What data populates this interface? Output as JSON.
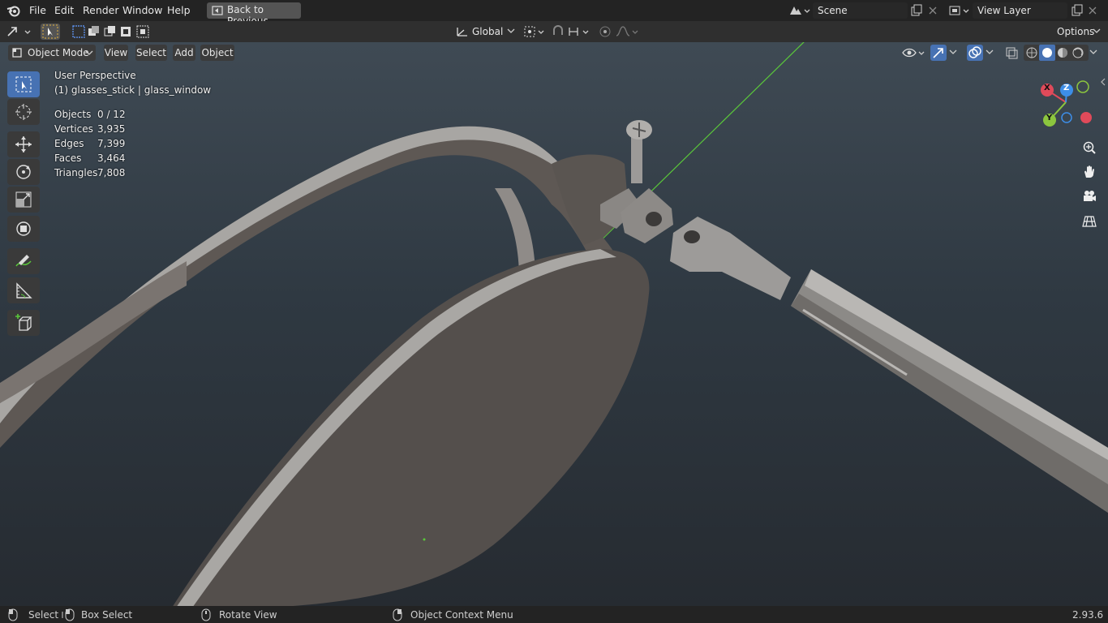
{
  "menu": {
    "file": "File",
    "edit": "Edit",
    "render": "Render",
    "window": "Window",
    "help": "Help",
    "back": "Back to Previous"
  },
  "scene": {
    "label": "Scene",
    "view_layer": "View Layer"
  },
  "toolbar": {
    "orientation": "Global",
    "options": "Options"
  },
  "header": {
    "mode": "Object Mode",
    "view": "View",
    "select": "Select",
    "add": "Add",
    "object": "Object"
  },
  "overlay": {
    "perspective": "User Perspective",
    "active": "(1) glasses_stick | glass_window"
  },
  "stats": [
    {
      "label": "Objects",
      "value": "0 / 12"
    },
    {
      "label": "Vertices",
      "value": "3,935"
    },
    {
      "label": "Edges",
      "value": "7,399"
    },
    {
      "label": "Faces",
      "value": "3,464"
    },
    {
      "label": "Triangles",
      "value": "7,808"
    }
  ],
  "gizmo": {
    "x": "X",
    "y": "Y",
    "z": "Z",
    "colors": {
      "x": "#e04a5a",
      "y": "#8cc63e",
      "z": "#3d8ee8"
    }
  },
  "status": {
    "select": "Select",
    "box_select": "Box Select",
    "rotate": "Rotate View",
    "context": "Object Context Menu",
    "version": "2.93.6"
  },
  "colors": {
    "accent": "#4772b3",
    "viewport_top": "#3f4a54",
    "viewport_bottom": "#262b31"
  }
}
